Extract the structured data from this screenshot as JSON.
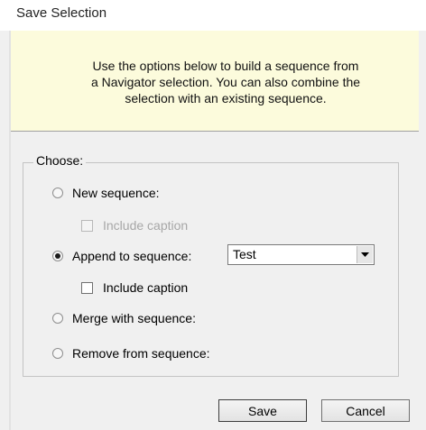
{
  "window": {
    "title": "Save Selection"
  },
  "banner": {
    "text_lines": [
      "Use the options below to build a sequence from",
      "a Navigator selection. You can also combine the",
      "selection with an existing sequence."
    ]
  },
  "group": {
    "legend": "Choose:",
    "options": {
      "new_sequence": {
        "label": "New sequence:",
        "selected": false
      },
      "new_include_caption": {
        "label": "Include caption",
        "checked": false,
        "enabled": false
      },
      "append_to_sequence": {
        "label": "Append to sequence:",
        "selected": true
      },
      "append_include_caption": {
        "label": "Include caption",
        "checked": false,
        "enabled": true
      },
      "merge_with_sequence": {
        "label": "Merge with sequence:",
        "selected": false
      },
      "remove_from_sequence": {
        "label": "Remove from sequence:",
        "selected": false
      }
    },
    "sequence_select": {
      "value": "Test"
    }
  },
  "buttons": {
    "save": "Save",
    "cancel": "Cancel"
  },
  "icons": {
    "dropdown": "chevron-down-icon"
  }
}
